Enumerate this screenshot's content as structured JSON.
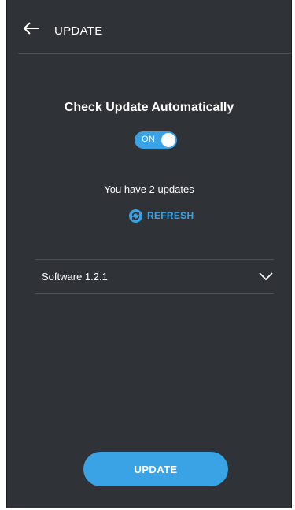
{
  "header": {
    "title": "UPDATE",
    "back_icon": "arrow-left-icon"
  },
  "auto_update": {
    "title": "Check Update Automatically",
    "toggle_label": "ON",
    "toggle_state": true
  },
  "updates": {
    "message": "You have 2 updates",
    "refresh_label": "REFRESH",
    "refresh_icon": "refresh-icon"
  },
  "software": {
    "label": "Software 1.2.1",
    "expand_icon": "chevron-down-icon"
  },
  "actions": {
    "update_label": "UPDATE"
  },
  "colors": {
    "background": "#2f3236",
    "accent": "#3aa3e6",
    "divider": "#4d5156",
    "text": "#ffffff"
  }
}
